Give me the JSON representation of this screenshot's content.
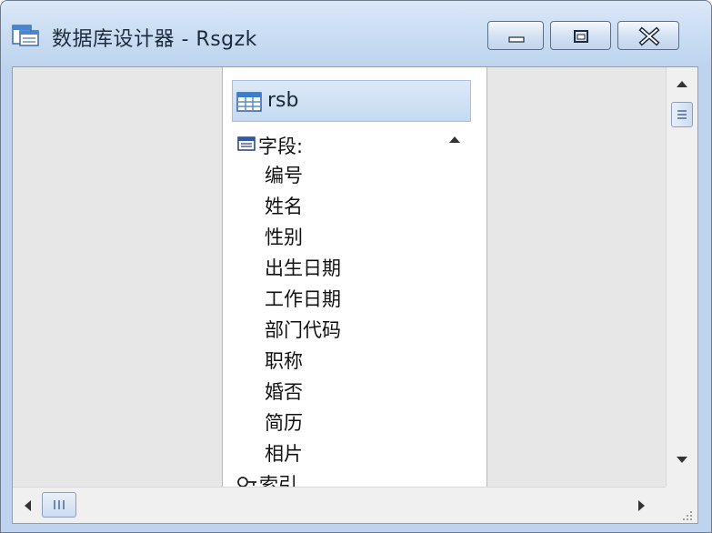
{
  "window": {
    "title": "数据库设计器 - Rsgzk",
    "controls": [
      "minimize",
      "maximize",
      "close"
    ]
  },
  "table": {
    "name": "rsb",
    "fields_header": "字段:",
    "fields": [
      "编号",
      "姓名",
      "性别",
      "出生日期",
      "工作日期",
      "部门代码",
      "职称",
      "婚否",
      "简历",
      "相片"
    ],
    "index_header": "索引"
  },
  "icons": {
    "window": "database-designer-icon",
    "table": "table-grid-icon",
    "fields": "field-list-icon",
    "index": "index-key-icon"
  },
  "colors": {
    "title_gradient_top": "#dbe8f7",
    "table_header": "#c5daf1",
    "canvas": "#e7e7e7"
  }
}
